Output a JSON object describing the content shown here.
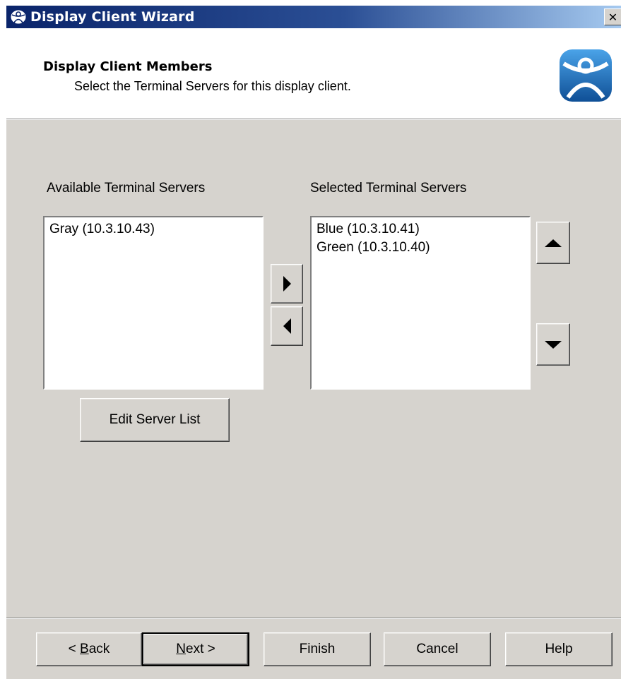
{
  "window": {
    "title": "Display Client Wizard",
    "close_glyph": "✕"
  },
  "header": {
    "title": "Display Client Members",
    "subtitle": "Select the Terminal Servers for this display client.",
    "logo_icon": "thinmanager-person-icon"
  },
  "available": {
    "label": "Available Terminal Servers",
    "items": [
      "Gray (10.3.10.43)"
    ]
  },
  "selected": {
    "label": "Selected Terminal Servers",
    "items": [
      "Blue (10.3.10.41)",
      "Green (10.3.10.40)"
    ]
  },
  "buttons": {
    "edit_server_list": "Edit Server List",
    "add_icon": "arrow-right-icon",
    "remove_icon": "arrow-left-icon",
    "move_up_icon": "arrow-up-icon",
    "move_down_icon": "arrow-down-icon"
  },
  "footer": {
    "back_prefix": "< ",
    "back_accel": "B",
    "back_rest": "ack",
    "next_accel": "N",
    "next_rest": "ext >",
    "finish": "Finish",
    "cancel": "Cancel",
    "help": "Help"
  },
  "colors": {
    "title_gradient_start": "#0a246a",
    "dialog_face": "#d6d3ce",
    "logo_blue": "#1b6fb8"
  }
}
